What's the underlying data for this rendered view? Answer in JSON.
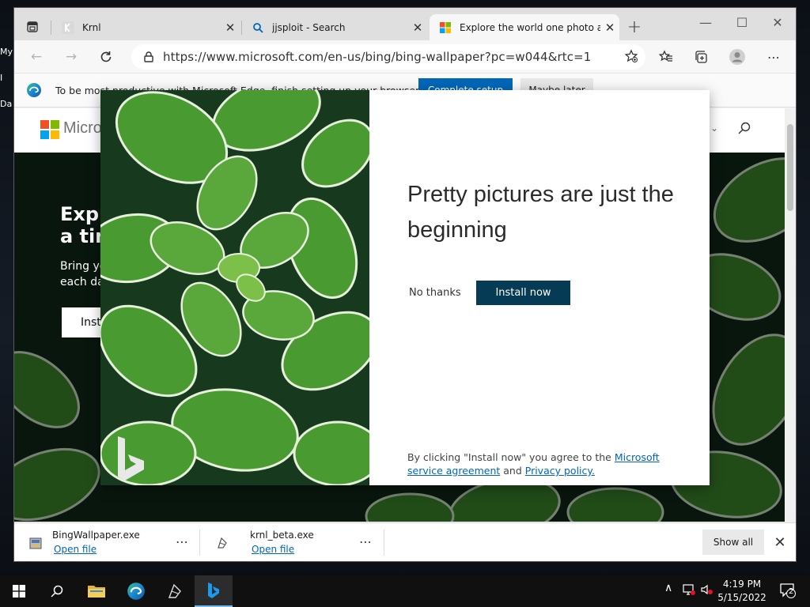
{
  "desktop": {
    "icon_labels": [
      "My",
      "I",
      "Da"
    ]
  },
  "browser": {
    "tabs": [
      {
        "title": "Krnl",
        "favicon": "krnl-icon"
      },
      {
        "title": "jjsploit - Search",
        "favicon": "search-icon"
      },
      {
        "title": "Explore the world one photo at a",
        "favicon": "microsoft-logo",
        "active": true
      }
    ],
    "new_tab": "+",
    "window_controls": {
      "minimize": "—",
      "maximize": "☐",
      "close": "✕"
    },
    "url": "https://www.microsoft.com/en-us/bing/bing-wallpaper?pc=w044&rtc=1",
    "toolbar_icons": [
      "back-icon",
      "forward-icon",
      "refresh-icon",
      "lock-icon",
      "add-favorite-icon",
      "favorites-icon",
      "collections-icon",
      "profile-icon",
      "more-icon"
    ],
    "more": "⋯"
  },
  "infobar": {
    "text": "To be most productive with Microsoft Edge, finish setting up your browser.",
    "primary": "Complete setup",
    "secondary": "Maybe later"
  },
  "page": {
    "brand": "Microsoft",
    "hero_title": "Explore the world one photo at\na time",
    "hero_sub": "Bring your desktop to life with\neach day",
    "hero_button": "Install now"
  },
  "modal": {
    "title": "Pretty pictures are just the beginning",
    "no_thanks": "No thanks",
    "install": "Install now",
    "legal_prefix": "By clicking \"Install now\" you agree to the ",
    "legal_link1": "Microsoft service agreement",
    "legal_mid": " and ",
    "legal_link2": "Privacy policy.",
    "logo": "bing-logo"
  },
  "downloads": [
    {
      "name": "BingWallpaper.exe",
      "action": "Open file",
      "icon": "installer-icon"
    },
    {
      "name": "krnl_beta.exe",
      "action": "Open file",
      "icon": "krnl-icon"
    }
  ],
  "download_more": "⋯",
  "show_all": "Show all",
  "taskbar": {
    "apps": [
      "start-icon",
      "search-icon",
      "file-explorer-icon",
      "edge-icon",
      "krnl-icon",
      "bing-icon"
    ],
    "time": "4:19 PM",
    "date": "5/15/2022",
    "notifications": "2"
  },
  "colors": {
    "accent": "#0067b8",
    "install_button": "#063b55",
    "leaf_green": "#3f8f2c"
  }
}
